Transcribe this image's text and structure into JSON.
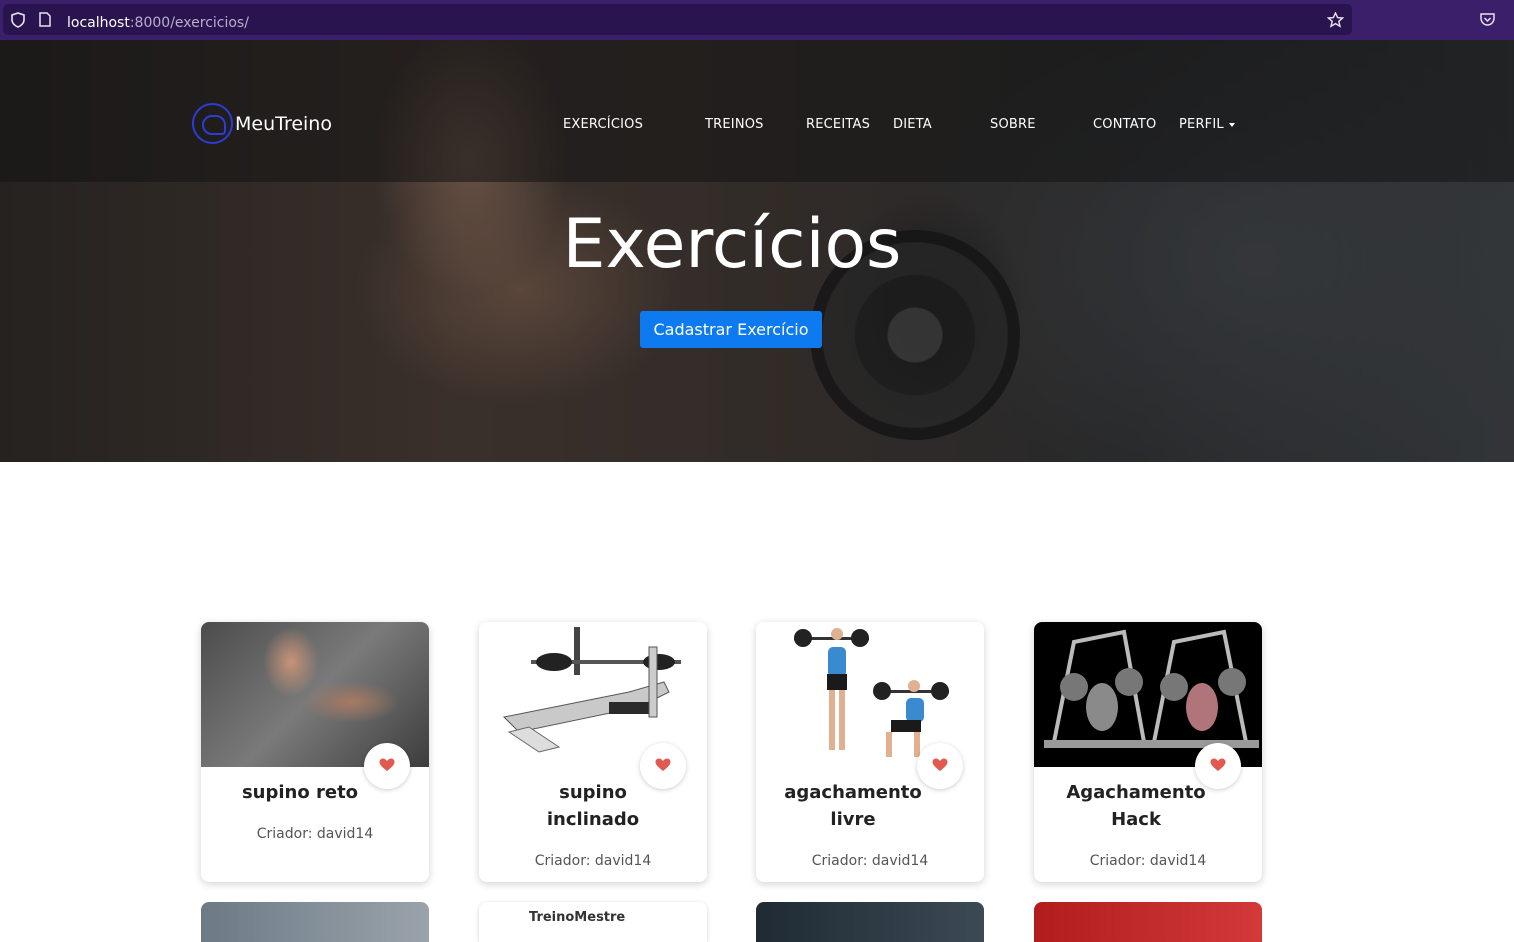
{
  "browser": {
    "url_host": "localhost",
    "url_path": ":8000/exercicios/"
  },
  "navbar": {
    "brand": "MeuTreino",
    "items": [
      "EXERCÍCIOS",
      "TREINOS",
      "RECEITAS",
      "DIETA",
      "SOBRE",
      "CONTATO"
    ],
    "profile": "PERFIL"
  },
  "hero": {
    "title": "Exercícios",
    "button": "Cadastrar Exercício"
  },
  "cards": [
    {
      "title": "supino reto",
      "creator": "Criador: david14"
    },
    {
      "title": "supino inclinado",
      "creator": "Criador: david14"
    },
    {
      "title": "agachamento livre",
      "creator": "Criador: david14"
    },
    {
      "title": "Agachamento Hack",
      "creator": "Criador: david14"
    }
  ],
  "second_row_brand": "TreinoMestre",
  "colors": {
    "browser": "#3b1f6b",
    "primary_button": "#0d7af0",
    "heart": "#e05a4f",
    "brand_logo": "#2d3bd8"
  },
  "icons": [
    "shield-icon",
    "page-icon",
    "star-icon",
    "pocket-icon",
    "heart-icon",
    "logo-icon"
  ]
}
